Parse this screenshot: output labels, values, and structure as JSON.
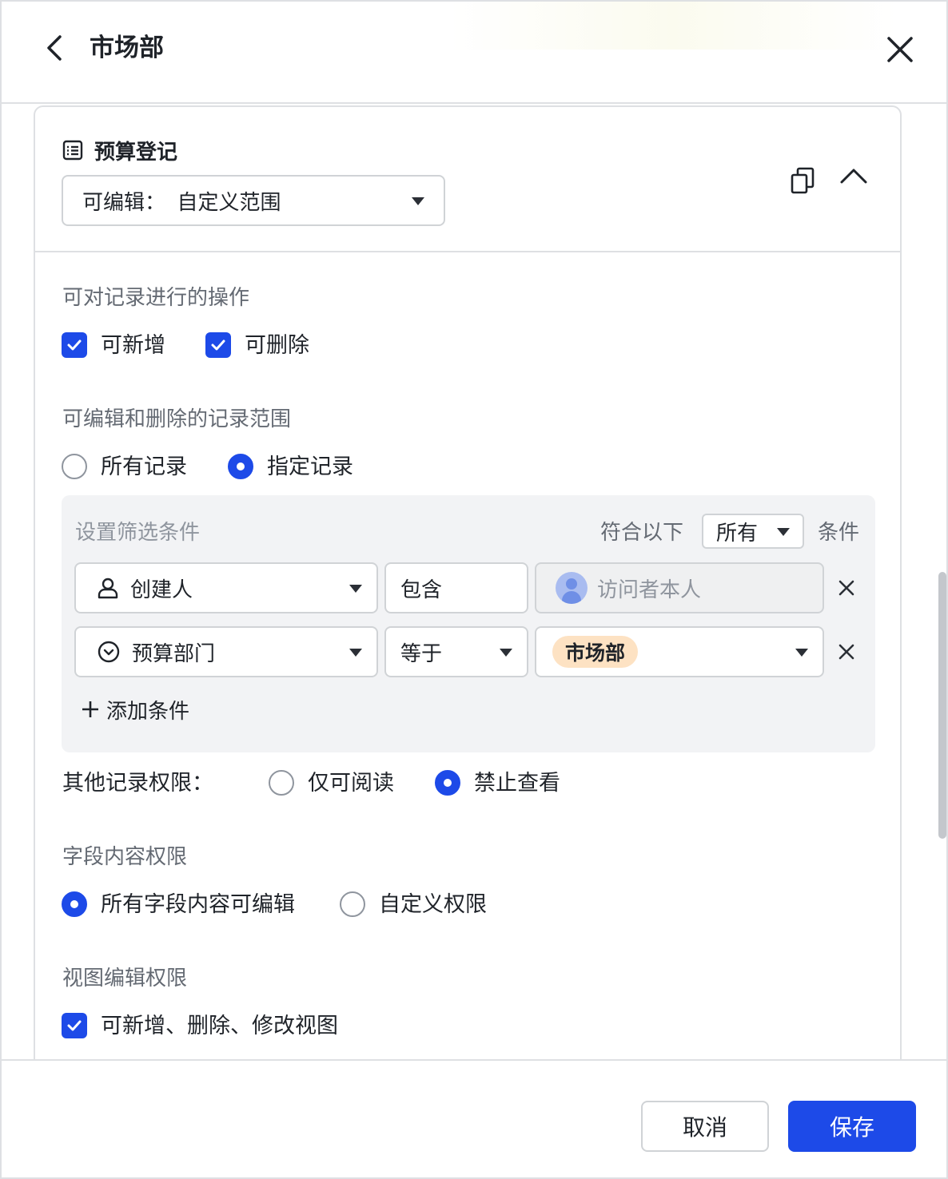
{
  "header": {
    "title": "市场部"
  },
  "card": {
    "table_name": "预算登记",
    "permission_select": "可编辑：  自定义范围"
  },
  "operations": {
    "label": "可对记录进行的操作",
    "add": {
      "label": "可新增",
      "checked": true
    },
    "delete": {
      "label": "可删除",
      "checked": true
    }
  },
  "scope": {
    "label": "可编辑和删除的记录范围",
    "options": [
      {
        "label": "所有记录",
        "selected": false
      },
      {
        "label": "指定记录",
        "selected": true
      }
    ]
  },
  "filter": {
    "title": "设置筛选条件",
    "match_prefix": "符合以下",
    "match_value": "所有",
    "match_suffix": "条件",
    "conditions": [
      {
        "field": "创建人",
        "field_icon": "person-icon",
        "operator": "包含",
        "value": "访问者本人"
      },
      {
        "field": "预算部门",
        "field_icon": "single-select-icon",
        "operator": "等于",
        "value": "市场部"
      }
    ],
    "add_condition": "添加条件"
  },
  "other_records": {
    "label": "其他记录权限：",
    "options": [
      {
        "label": "仅可阅读",
        "selected": false
      },
      {
        "label": "禁止查看",
        "selected": true
      }
    ]
  },
  "field_perm": {
    "label": "字段内容权限",
    "options": [
      {
        "label": "所有字段内容可编辑",
        "selected": true
      },
      {
        "label": "自定义权限",
        "selected": false
      }
    ]
  },
  "view_perm": {
    "label": "视图编辑权限",
    "option": {
      "label": "可新增、删除、修改视图",
      "checked": true
    }
  },
  "footer": {
    "cancel": "取消",
    "save": "保存"
  },
  "colors": {
    "accent": "#1d4ae8",
    "tag_bg": "#fde2c3"
  }
}
